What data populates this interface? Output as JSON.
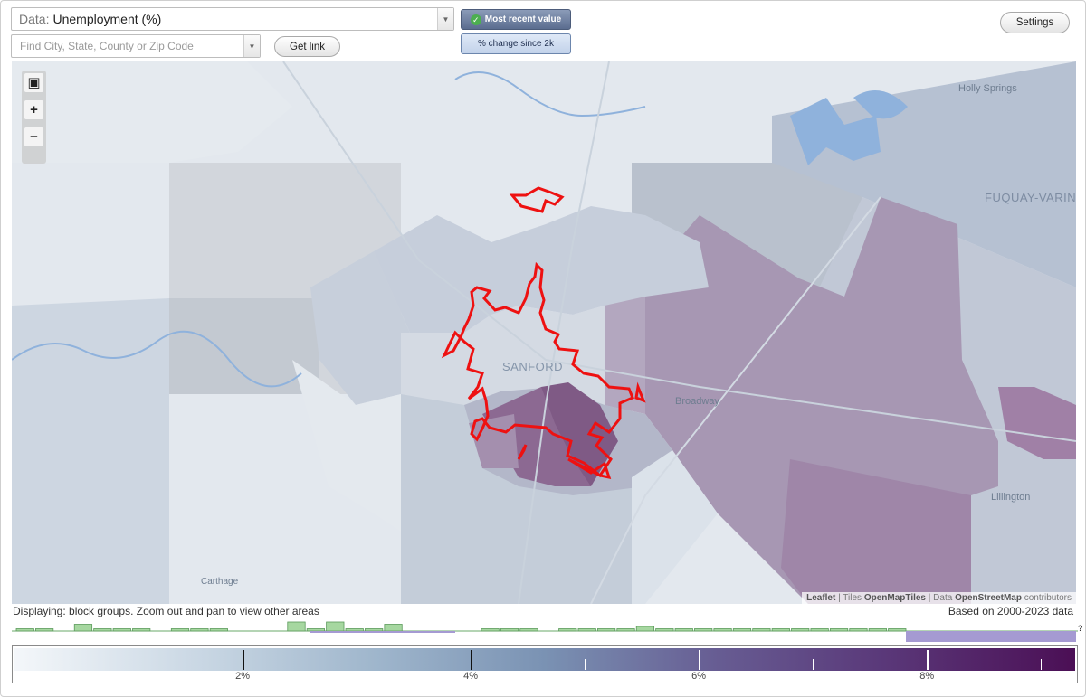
{
  "controls": {
    "data_prefix": "Data:",
    "data_value": "Unemployment (%)",
    "search_placeholder": "Find City, State, County or Zip Code",
    "get_link": "Get link",
    "settings": "Settings",
    "toggle_recent": "Most recent value",
    "toggle_change": "% change since 2k"
  },
  "map": {
    "labels": {
      "holly_springs": "Holly Springs",
      "fuquay": "FUQUAY-VARINA",
      "sanford": "SANFORD",
      "broadway": "Broadway",
      "lillington": "Lillington",
      "carthage": "Carthage"
    },
    "attribution": {
      "leaflet": "Leaflet",
      "sep1": " | Tiles ",
      "tiles": "OpenMapTiles",
      "sep2": " | Data ",
      "data": "OpenStreetMap",
      "contrib": " contributors"
    },
    "colors": {
      "outline": "#ee1111",
      "water": "#7fa6d4",
      "low": "#dde4ec",
      "high": "#6b3c73"
    }
  },
  "footer": {
    "displaying": "Displaying: block groups. Zoom out and pan to view other areas",
    "based_on": "Based on 2000-2023 data",
    "help": "?"
  },
  "legend": {
    "min": 0,
    "max": 9.3,
    "major_ticks": [
      {
        "value": 2,
        "label": "2%"
      },
      {
        "value": 4,
        "label": "4%"
      },
      {
        "value": 6,
        "label": "6%"
      },
      {
        "value": 8,
        "label": "8%"
      }
    ],
    "minor_ticks": [
      1,
      3,
      5,
      7,
      9
    ]
  },
  "histogram": {
    "bins": [
      1,
      1,
      0,
      3,
      1,
      1,
      1,
      0,
      1,
      1,
      1,
      0,
      0,
      0,
      4,
      1,
      4,
      1,
      1,
      3,
      0,
      0,
      0,
      0,
      1,
      1,
      1,
      0,
      1,
      1,
      1,
      1,
      2,
      1,
      1,
      1,
      1,
      1,
      1,
      1,
      1,
      1,
      1,
      1,
      1,
      1
    ]
  }
}
